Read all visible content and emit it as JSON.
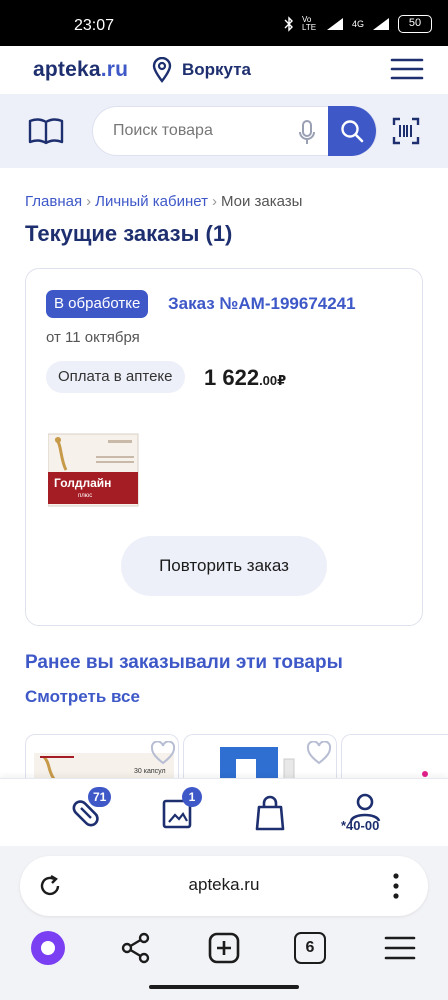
{
  "status": {
    "time": "23:07",
    "signal_label": "Vo LTE",
    "net": "4G",
    "battery": "50"
  },
  "header": {
    "logo_main": "apteka",
    "logo_tld": ".ru",
    "city": "Воркута"
  },
  "search": {
    "placeholder": "Поиск товара"
  },
  "breadcrumb": {
    "home": "Главная",
    "sep": "›",
    "cabinet": "Личный кабинет",
    "current": "Мои заказы"
  },
  "page_title": "Текущие заказы (1)",
  "order": {
    "status": "В обработке",
    "number": "Заказ №АМ-199674241",
    "date": "от 11 октября",
    "payment": "Оплата в аптеке",
    "price_main": "1 622",
    "price_cents": ".00",
    "currency": "₽",
    "product_name": "Голдлайн",
    "product_sub": "плюс",
    "repeat_button": "Повторить заказ"
  },
  "previous": {
    "title": "Ранее вы заказывали эти товары",
    "see_all": "Смотреть все",
    "card1_note": "30 капсул"
  },
  "bottom_nav": {
    "favorites_count": "71",
    "compare_count": "1",
    "account_label": "*40-00"
  },
  "browser": {
    "url": "apteka.ru",
    "tabs_count": "6"
  },
  "colors": {
    "brand": "#3e58c8",
    "navy": "#1e2f6f",
    "light_bg": "#eef0f9"
  }
}
